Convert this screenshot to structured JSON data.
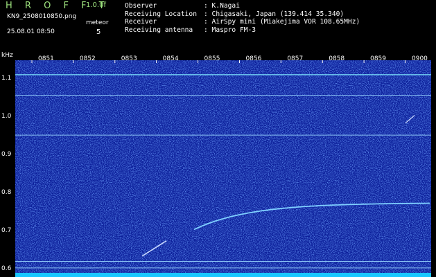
{
  "header": {
    "app_title": "H R O F F T",
    "version": "1.0.0f",
    "filename": "KN9_2508010850.png",
    "meteor_label": "meteor",
    "datetime": "25.08.01 08:50",
    "meteor_count": "5"
  },
  "info": [
    {
      "key": "Observer",
      "value": ": K.Nagai"
    },
    {
      "key": "Receiving Location",
      "value": ": Chigasaki, Japan (139.414 35.340)"
    },
    {
      "key": "Receiver",
      "value": ": AirSpy mini (Miakejima VOR 108.65MHz)"
    },
    {
      "key": "Receiving antenna",
      "value": ": Maspro FM-3"
    }
  ],
  "chart_data": {
    "type": "heatmap",
    "ylabel": "kHz",
    "x_ticks": [
      "0851",
      "0852",
      "0853",
      "0854",
      "0855",
      "0856",
      "0857",
      "0858",
      "0859",
      "0900"
    ],
    "y_ticks": [
      "1.1",
      "1.0",
      "0.9",
      "0.8",
      "0.7",
      "0.6"
    ],
    "ylim": [
      0.58,
      1.15
    ],
    "background_color": "#0c1f9a",
    "carrier_lines_khz": [
      1.112,
      1.058,
      0.953,
      0.621,
      0.604
    ],
    "trace_color": "#7fd0ff"
  }
}
